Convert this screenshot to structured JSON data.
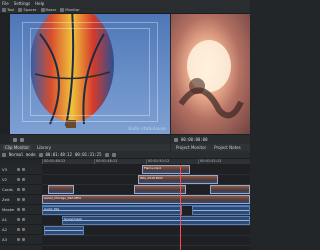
{
  "menubar": [
    "File",
    "Settings",
    "Help"
  ],
  "toolbar": [
    {
      "icon": "scissors-icon",
      "label": "Tool"
    },
    {
      "icon": "spacer-icon",
      "label": "Spacer"
    },
    {
      "icon": "razor-icon",
      "label": "Razor"
    },
    {
      "icon": "monitor-icon",
      "label": "Monitor"
    }
  ],
  "clip_monitor": {
    "watermark": "Kolte stabiilsuse"
  },
  "monitor_bar": {
    "timecode": "00:00:00:00"
  },
  "tabs": [
    {
      "label": "Clip Monitor",
      "active": true
    },
    {
      "label": "Library",
      "active": false
    },
    {
      "label": "Project Monitor",
      "active": false
    },
    {
      "label": "Project Notes",
      "active": false
    }
  ],
  "timeline_toolbar": {
    "mode": "Normal mode",
    "timecode_1": "00:01:48:12",
    "timecode_2": "00:01:31:25"
  },
  "ruler": [
    "00:01:46:12",
    "00:01:48:12",
    "00:01:50:12",
    "00:01:52:12"
  ],
  "tracks": [
    {
      "label": "V3"
    },
    {
      "label": "V2"
    },
    {
      "label": "Cards"
    },
    {
      "label": "Zeit"
    },
    {
      "label": "Maske"
    },
    {
      "label": "A1"
    },
    {
      "label": "A2"
    },
    {
      "label": "A3"
    }
  ],
  "clips": {
    "v2_a": "Flame.mp4",
    "v2_b": "IMG_2018.MOV",
    "v1_a": "Aerial_Chicago_Part.MP4",
    "a1_a": "Audio_Mix",
    "a2_a": "Sound track"
  }
}
